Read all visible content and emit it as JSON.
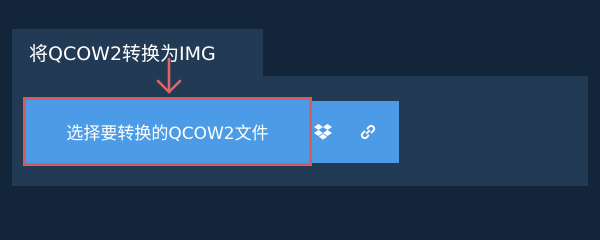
{
  "header": {
    "title": "将QCOW2转换为IMG"
  },
  "upload": {
    "button_label": "选择要转换的QCOW2文件"
  },
  "icons": {
    "dropbox": "dropbox-icon",
    "link": "link-icon",
    "arrow": "arrow-down-icon"
  },
  "colors": {
    "background": "#13253b",
    "panel": "#233a55",
    "accent": "#4c9be6",
    "highlight": "#d65c5c"
  }
}
